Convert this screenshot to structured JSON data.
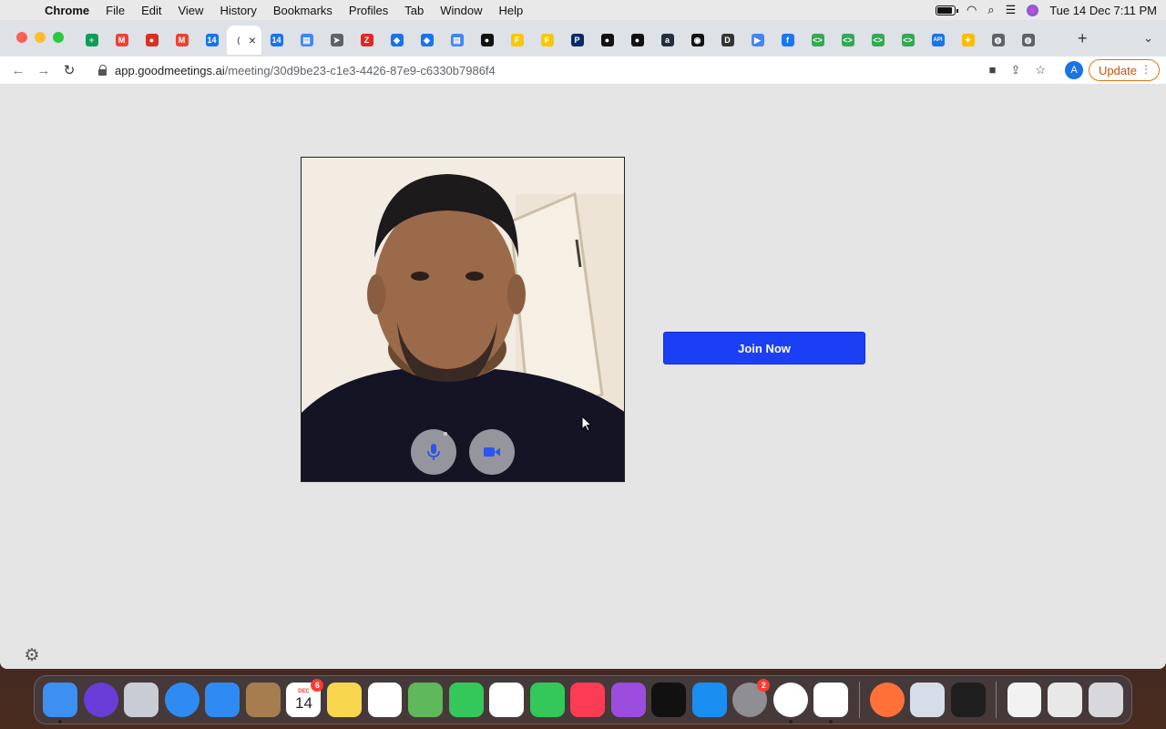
{
  "menubar": {
    "app_name": "Chrome",
    "menus": [
      "File",
      "Edit",
      "View",
      "History",
      "Bookmarks",
      "Profiles",
      "Tab",
      "Window",
      "Help"
    ],
    "clock": "Tue 14 Dec  7:11 PM"
  },
  "browser": {
    "tabs": [
      {
        "icon": "google-sheets-icon",
        "color": "#0f9d58",
        "glyph": "+"
      },
      {
        "icon": "gmail-icon",
        "color": "#ea4335",
        "glyph": "M"
      },
      {
        "icon": "record-icon",
        "color": "#d93025",
        "glyph": "●"
      },
      {
        "icon": "gmail-icon",
        "color": "#ea4335",
        "glyph": "M"
      },
      {
        "icon": "calendar-icon",
        "color": "#1a73e8",
        "glyph": "14"
      },
      {
        "icon": "active-tab-icon",
        "color": "#5f6368",
        "glyph": "("
      },
      {
        "icon": "calendar-icon",
        "color": "#1a73e8",
        "glyph": "14"
      },
      {
        "icon": "store-icon",
        "color": "#4285f4",
        "glyph": "▤"
      },
      {
        "icon": "arrow-icon",
        "color": "#5f6368",
        "glyph": "➤"
      },
      {
        "icon": "zoho-icon",
        "color": "#e42527",
        "glyph": "Z"
      },
      {
        "icon": "diamond-icon",
        "color": "#1a73e8",
        "glyph": "◆"
      },
      {
        "icon": "diamond-icon",
        "color": "#1a73e8",
        "glyph": "◆"
      },
      {
        "icon": "store-icon",
        "color": "#4285f4",
        "glyph": "▤"
      },
      {
        "icon": "dot-icon",
        "color": "#111111",
        "glyph": "●"
      },
      {
        "icon": "flipkart-icon",
        "color": "#f8c900",
        "glyph": "F"
      },
      {
        "icon": "flipkart-icon",
        "color": "#f8c900",
        "glyph": "F"
      },
      {
        "icon": "p-icon",
        "color": "#0a2a66",
        "glyph": "P"
      },
      {
        "icon": "dot-icon",
        "color": "#111111",
        "glyph": "●"
      },
      {
        "icon": "dot-icon",
        "color": "#111111",
        "glyph": "●"
      },
      {
        "icon": "amazon-icon",
        "color": "#232f3e",
        "glyph": "a"
      },
      {
        "icon": "github-icon",
        "color": "#111111",
        "glyph": "◉"
      },
      {
        "icon": "d-icon",
        "color": "#333333",
        "glyph": "D"
      },
      {
        "icon": "play-icon",
        "color": "#4285f4",
        "glyph": "▶"
      },
      {
        "icon": "facebook-icon",
        "color": "#1877f2",
        "glyph": "f"
      },
      {
        "icon": "code-icon",
        "color": "#34a853",
        "glyph": "<>"
      },
      {
        "icon": "code-icon",
        "color": "#34a853",
        "glyph": "<>"
      },
      {
        "icon": "code-icon",
        "color": "#34a853",
        "glyph": "<>"
      },
      {
        "icon": "code-icon",
        "color": "#34a853",
        "glyph": "<>"
      },
      {
        "icon": "api-icon",
        "color": "#1a73e8",
        "glyph": "API"
      },
      {
        "icon": "colorful-icon",
        "color": "#fbbc05",
        "glyph": "✦"
      },
      {
        "icon": "globe-icon",
        "color": "#5f6368",
        "glyph": "◍"
      },
      {
        "icon": "globe-icon",
        "color": "#5f6368",
        "glyph": "◍"
      }
    ],
    "url_domain": "app.goodmeetings.ai",
    "url_path": "/meeting/30d9be23-c1e3-4426-87e9-c6330b7986f4",
    "profile_initial": "A",
    "update_label": "Update"
  },
  "meeting": {
    "join_label": "Join Now",
    "join_color": "#1b3ff5",
    "mic_icon": "microphone-icon",
    "camera_icon": "video-camera-icon",
    "settings_icon": "gear-icon"
  },
  "dock": {
    "calendar_month": "DEC",
    "calendar_day": "14",
    "calendar_badge": "6",
    "settings_badge": "2",
    "apps": [
      "finder-icon",
      "siri-icon",
      "launchpad-icon",
      "safari-icon",
      "mail-icon",
      "contacts-icon",
      "calendar-icon",
      "notes-icon",
      "reminders-icon",
      "maps-icon",
      "messages-icon",
      "photos-icon",
      "facetime-icon",
      "music-icon",
      "podcasts-icon",
      "apple-tv-icon",
      "app-store-icon",
      "system-preferences-icon",
      "chrome-icon",
      "vscode-icon",
      "firefox-icon",
      "preview-icon",
      "terminal-icon",
      "chrome-window-icon",
      "chrome-minimized-icon",
      "trash-icon"
    ]
  }
}
